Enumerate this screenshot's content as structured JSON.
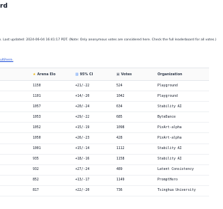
{
  "page": {
    "title": "rd",
    "notice": "ı. Last updated: 2024-06-04 16:41:17 PDT. (Note: Only anonymous votes are considered here. Check the full leaderboard for all votes.)",
    "link_text": "ultihere",
    "link_tail": "."
  },
  "table": {
    "headers": {
      "elo": "Arena Elo",
      "ci": "95% CI",
      "votes": "Votes",
      "org": "Organization"
    },
    "header_icons": {
      "elo": "star-icon",
      "ci": "bar-chart-icon",
      "votes": "ballot-icon"
    },
    "rows": [
      {
        "elo": "1150",
        "ci": "+21/-22",
        "votes": "524",
        "org": "Playground"
      },
      {
        "elo": "1101",
        "ci": "+14/-20",
        "votes": "1042",
        "org": "Playground"
      },
      {
        "elo": "1057",
        "ci": "+20/-24",
        "votes": "634",
        "org": "Stability AI"
      },
      {
        "elo": "1053",
        "ci": "+29/-22",
        "votes": "685",
        "org": "ByteDance"
      },
      {
        "elo": "1052",
        "ci": "+15/-19",
        "votes": "1098",
        "org": "PixArt-alpha"
      },
      {
        "elo": "1050",
        "ci": "+26/-23",
        "votes": "428",
        "org": "PixArt-alpha"
      },
      {
        "elo": "1001",
        "ci": "+15/-14",
        "votes": "1112",
        "org": "Stability AI"
      },
      {
        "elo": "935",
        "ci": "+18/-16",
        "votes": "1158",
        "org": "Stability AI"
      },
      {
        "elo": "932",
        "ci": "+27/-24",
        "votes": "489",
        "org": "Latent Consistency"
      },
      {
        "elo": "852",
        "ci": "+13/-17",
        "votes": "1149",
        "org": "PromptHero"
      },
      {
        "elo": "817",
        "ci": "+22/-20",
        "votes": "736",
        "org": "Tsinghua University"
      }
    ]
  },
  "colors": {
    "link": "#1d4ed8",
    "star": "#eab308",
    "chart": "#3b82f6"
  }
}
